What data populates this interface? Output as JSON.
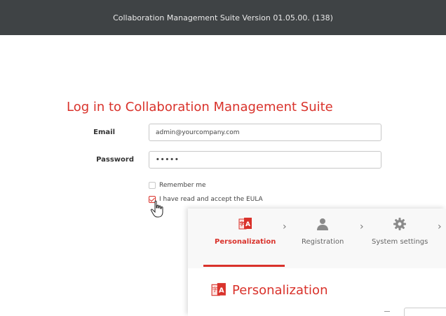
{
  "header": {
    "title": "Collaboration Management Suite Version 01.05.00. (138)"
  },
  "login": {
    "heading": "Log in to Collaboration Management Suite",
    "email_label": "Email",
    "email_value": "admin@yourcompany.com",
    "password_label": "Password",
    "password_value": "•••••",
    "remember_label": "Remember me",
    "remember_checked": false,
    "eula_label": "I have read and accept the EULA",
    "eula_checked": true
  },
  "wizard": {
    "steps": [
      {
        "label": "Personalization",
        "icon": "language-icon",
        "active": true
      },
      {
        "label": "Registration",
        "icon": "user-icon",
        "active": false
      },
      {
        "label": "System settings",
        "icon": "gear-icon",
        "active": false
      }
    ],
    "section_title": "Personalization"
  },
  "colors": {
    "accent": "#d9322b",
    "header_bg": "#3f4345"
  }
}
